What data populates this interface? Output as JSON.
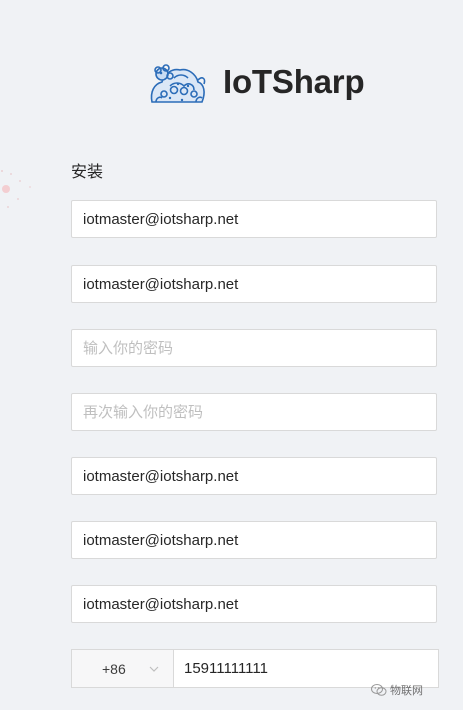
{
  "brand": {
    "name": "IoTSharp",
    "logo_icon": "qilin-lion-logo-icon",
    "logo_color": "#2b6cb8"
  },
  "form": {
    "title": "安装",
    "fields": [
      {
        "value": "iotmaster@iotsharp.net",
        "placeholder": ""
      },
      {
        "value": "iotmaster@iotsharp.net",
        "placeholder": ""
      },
      {
        "value": "",
        "placeholder": "输入你的密码"
      },
      {
        "value": "",
        "placeholder": "再次输入你的密码"
      },
      {
        "value": "iotmaster@iotsharp.net",
        "placeholder": ""
      },
      {
        "value": "iotmaster@iotsharp.net",
        "placeholder": ""
      },
      {
        "value": "iotmaster@iotsharp.net",
        "placeholder": ""
      }
    ],
    "phone": {
      "country_code": "+86",
      "number": "15911111111",
      "chevron_icon": "chevron-down-icon"
    }
  },
  "watermark": {
    "text": "物联网",
    "icon": "wechat-icon"
  },
  "colors": {
    "background": "#f0f2f5",
    "border": "#d9d9d9",
    "placeholder": "#bfbfbf",
    "text": "#262626"
  }
}
